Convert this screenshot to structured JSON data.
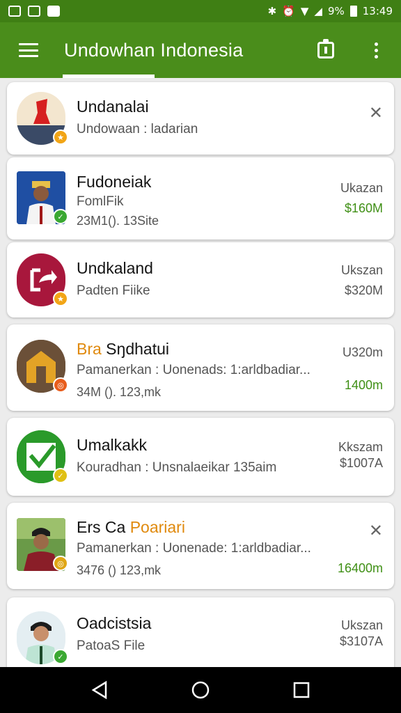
{
  "status_bar": {
    "battery_text": "9%",
    "time": "13:49"
  },
  "app_bar": {
    "title": "Undowhan Indonesia"
  },
  "items": [
    {
      "name": "Undanalai",
      "name_highlight": "",
      "subtitle": "Undowaan : ladarian",
      "subtitle2": "",
      "meta_label": "",
      "meta_value": "",
      "meta_value_green": false,
      "has_close": true,
      "avatar_icon": "flag-icon",
      "badge_color": "#f2a516",
      "badge_icon": "star-icon"
    },
    {
      "name": "Fudoneiak",
      "name_highlight": "",
      "subtitle": "FomlFik",
      "subtitle2": "23M1(). 13Site",
      "meta_label": "Ukazan",
      "meta_value": "$160M",
      "meta_value_green": true,
      "has_close": false,
      "avatar_icon": "person-photo",
      "badge_color": "#3aa832",
      "badge_icon": "check-icon"
    },
    {
      "name": "Undkaland",
      "name_highlight": "",
      "subtitle": "Padten Fiike",
      "subtitle2": "",
      "meta_label": "Ukszan",
      "meta_value": "$320M",
      "meta_value_green": false,
      "has_close": false,
      "avatar_icon": "share-icon",
      "badge_color": "#f2a516",
      "badge_icon": "star-icon"
    },
    {
      "name": "Bra Sŋdhatui",
      "name_highlight": "Bra",
      "subtitle": "Pamanerkan : Uonenads: 1:arldbadiar...",
      "subtitle2": "34M (). 123,mk",
      "meta_label": "U320m",
      "meta_value": "1400m",
      "meta_value_green": true,
      "has_close": false,
      "avatar_icon": "house-icon",
      "badge_color": "#e85d1c",
      "badge_icon": "circle-icon"
    },
    {
      "name": "Umalkakk",
      "name_highlight": "",
      "subtitle": "Kouradhan : Unsnalaeikar 135aim",
      "subtitle2": "",
      "meta_label": "Kkszam",
      "meta_value": "$1007A",
      "meta_value_green": false,
      "has_close": false,
      "avatar_icon": "checkbox-icon",
      "badge_color": "#e0c014",
      "badge_icon": "check-icon"
    },
    {
      "name": "Ers Ca Poariari",
      "name_highlight": "Poariari",
      "subtitle": "Pamanerkan : Uonenade: 1:arldbadiar...",
      "subtitle2": "3476 () 123,mk",
      "meta_label": "",
      "meta_value": "16400m",
      "meta_value_green": true,
      "has_close": true,
      "avatar_icon": "person-photo",
      "badge_color": "#e0a614",
      "badge_icon": "circle-icon"
    },
    {
      "name": "Oadcistsia",
      "name_highlight": "",
      "subtitle": "PatoaS File",
      "subtitle2": "",
      "meta_label": "Ukszan",
      "meta_value": "$3107A",
      "meta_value_green": false,
      "has_close": false,
      "avatar_icon": "person-photo",
      "badge_color": "#3aa832",
      "badge_icon": "check-icon"
    }
  ],
  "colors": {
    "app_bar": "#4a8d1b",
    "status_bar": "#3f7f14",
    "accent_green": "#3f8f15",
    "highlight_orange": "#e08a0e"
  }
}
